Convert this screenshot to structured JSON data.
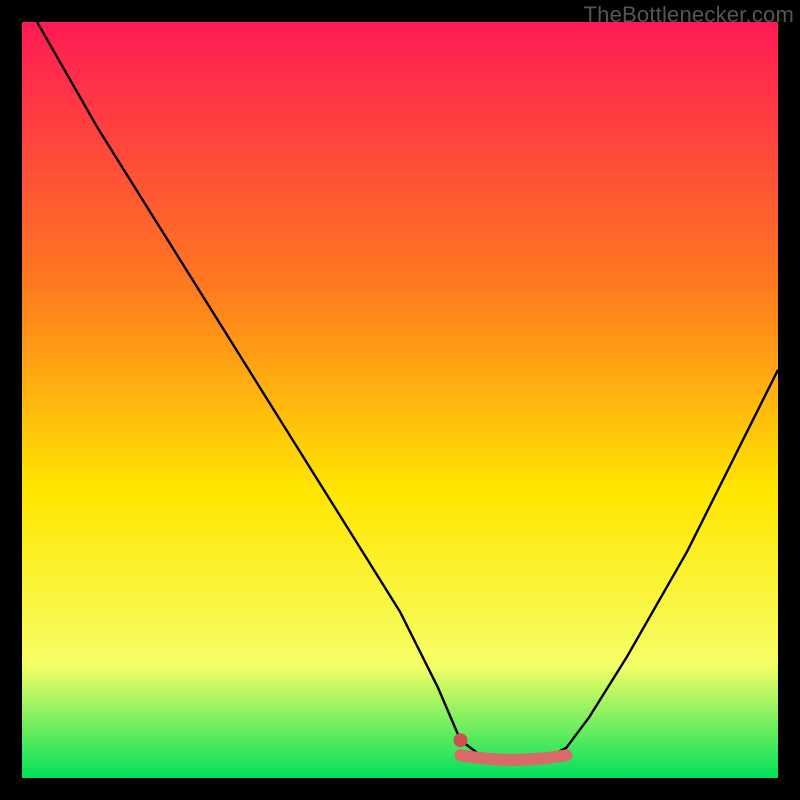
{
  "attribution": "TheBottlenecker.com",
  "colors": {
    "gradient_top": "#ff1a55",
    "gradient_mid1": "#ff7a1f",
    "gradient_mid2": "#ffe600",
    "gradient_mid3": "#f6ff66",
    "gradient_bottom": "#00e05a",
    "curve": "#000000",
    "marker_fill": "#d96a6a",
    "marker_dot": "#d04f4f"
  },
  "chart_data": {
    "type": "line",
    "title": "",
    "xlabel": "",
    "ylabel": "",
    "xlim": [
      0,
      100
    ],
    "ylim": [
      0,
      100
    ],
    "series": [
      {
        "name": "bottleneck-curve",
        "x": [
          2,
          10,
          20,
          30,
          40,
          50,
          55,
          58,
          62,
          68,
          72,
          75,
          80,
          88,
          95,
          100
        ],
        "y": [
          100,
          86,
          70,
          54,
          38,
          22,
          12,
          5,
          2,
          2,
          4,
          8,
          16,
          30,
          44,
          54
        ]
      }
    ],
    "optimum_band": {
      "x_start": 58,
      "x_end": 72,
      "y": 3
    },
    "optimum_dot": {
      "x": 58,
      "y": 5
    }
  }
}
